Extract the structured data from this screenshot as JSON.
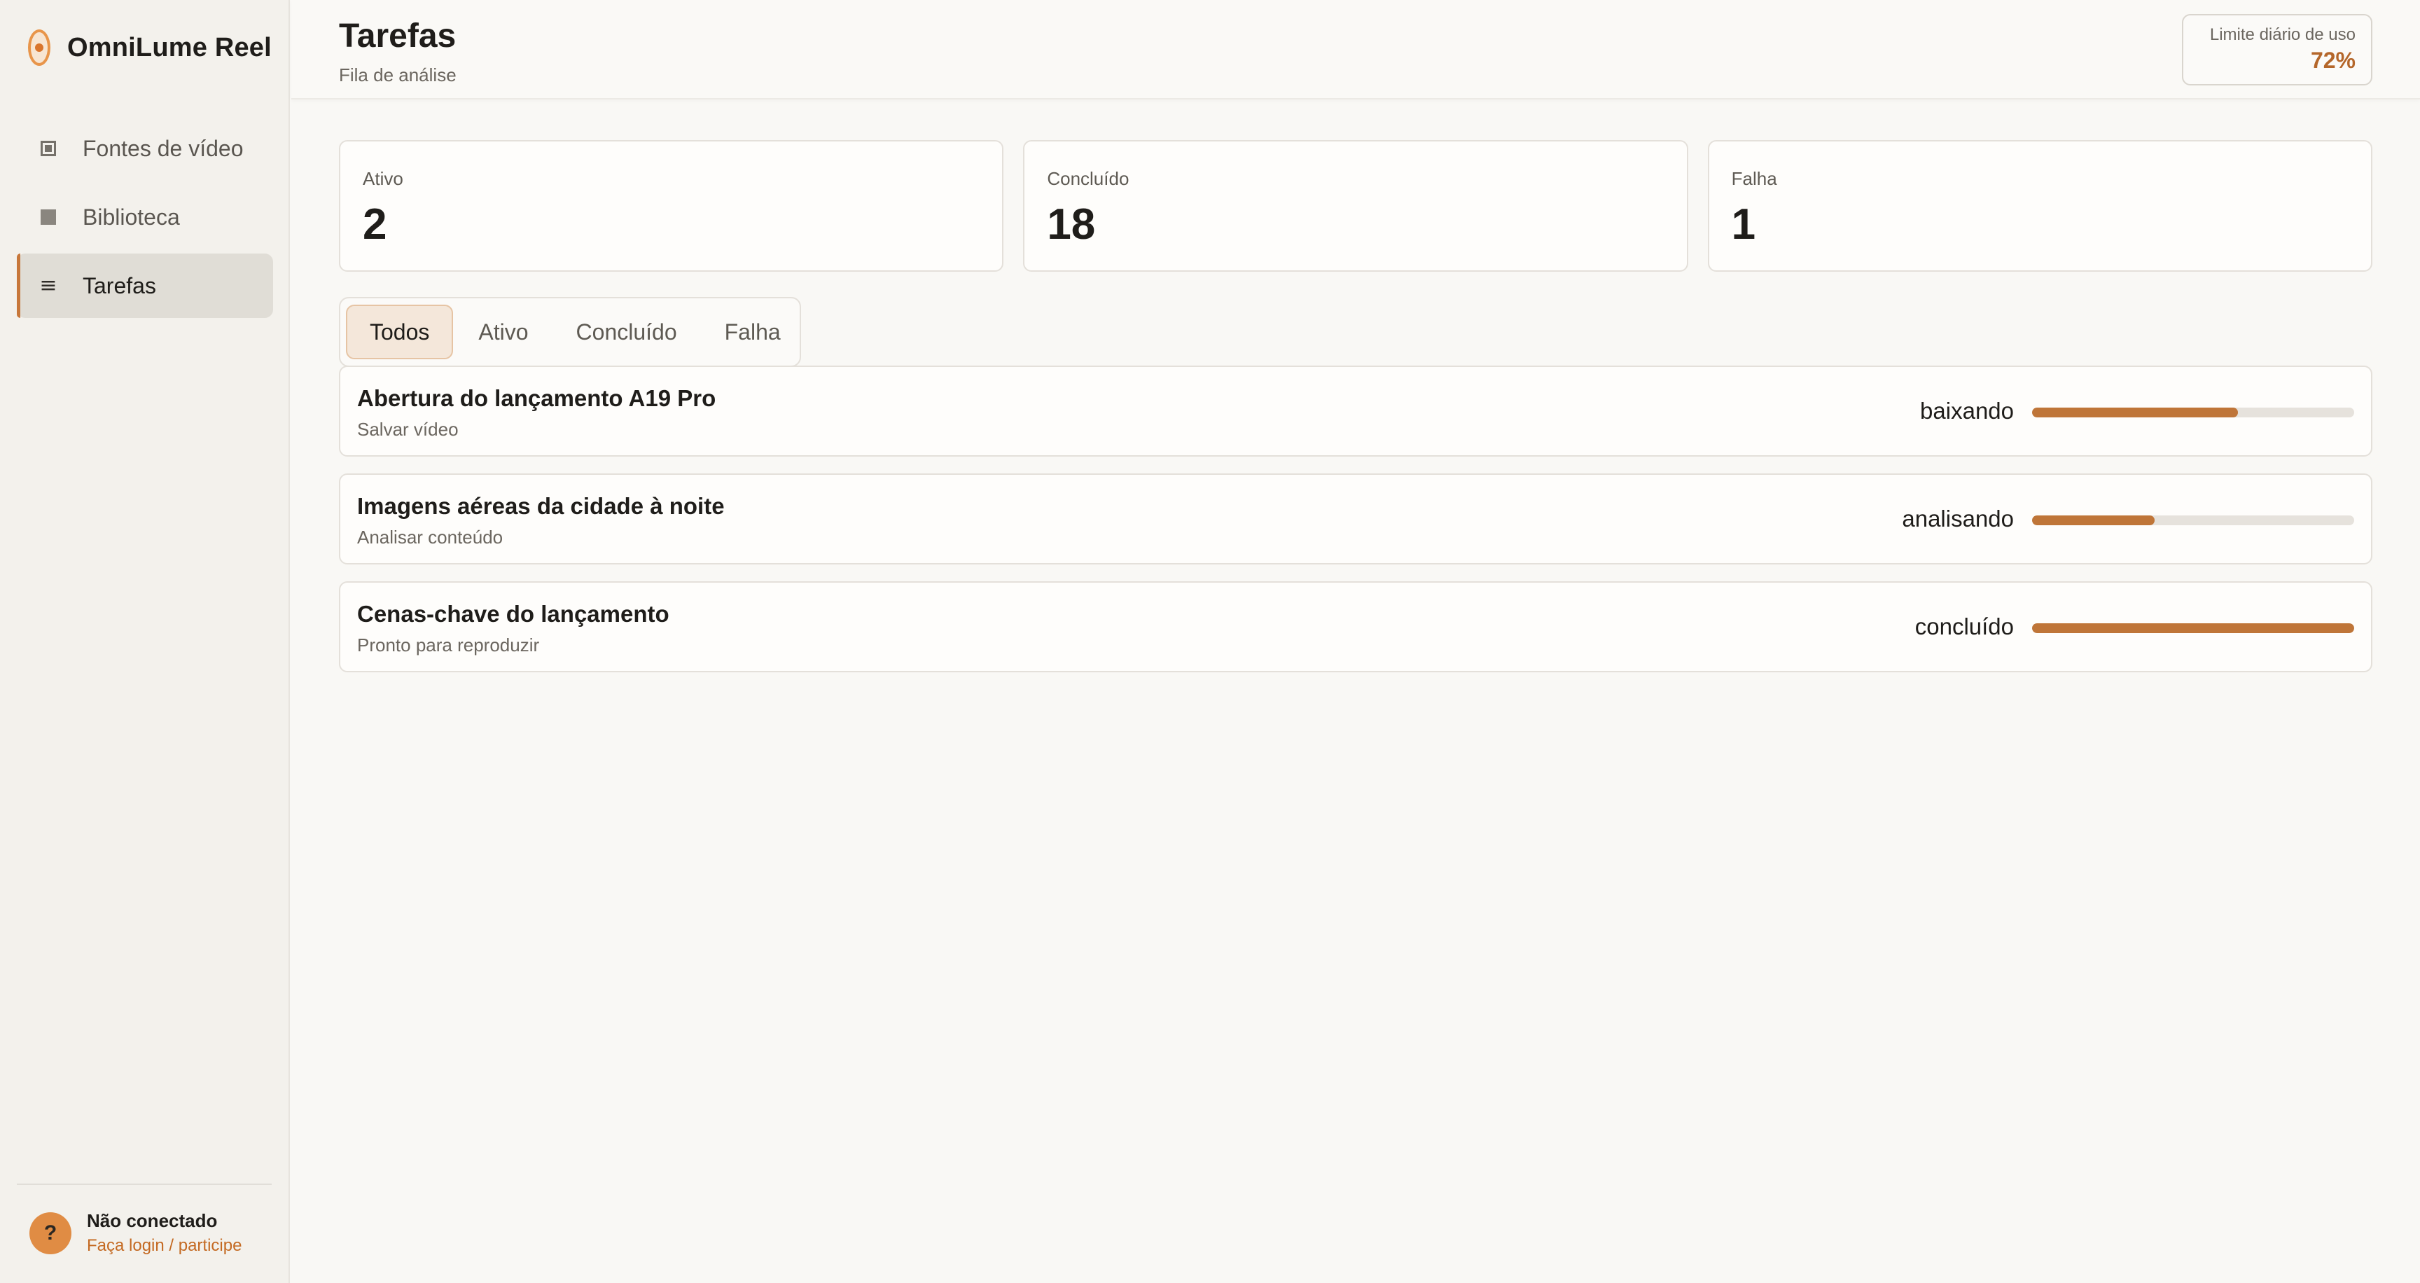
{
  "app": {
    "name": "OmniLume Reel",
    "accent": "#c7773a"
  },
  "sidebar": {
    "items": [
      {
        "label": "Fontes de vídeo",
        "icon": "video-source-icon",
        "active": false
      },
      {
        "label": "Biblioteca",
        "icon": "library-icon",
        "active": false
      },
      {
        "label": "Tarefas",
        "icon": "list-icon",
        "active": true
      }
    ],
    "footer": {
      "avatar": "?",
      "status": "Não conectado",
      "login": "Faça login / participe"
    }
  },
  "header": {
    "title": "Tarefas",
    "subtitle": "Fila de análise",
    "usage_label": "Limite diário de uso",
    "usage_value": "72%"
  },
  "stats": [
    {
      "label": "Ativo",
      "value": "2"
    },
    {
      "label": "Concluído",
      "value": "18"
    },
    {
      "label": "Falha",
      "value": "1"
    }
  ],
  "tabs": [
    {
      "label": "Todos",
      "active": true
    },
    {
      "label": "Ativo",
      "active": false
    },
    {
      "label": "Concluído",
      "active": false
    },
    {
      "label": "Falha",
      "active": false
    }
  ],
  "tasks": [
    {
      "title": "Abertura do lançamento A19 Pro",
      "subtitle": "Salvar vídeo",
      "state": "baixando",
      "progress": 0.64
    },
    {
      "title": "Imagens aéreas da cidade à noite",
      "subtitle": "Analisar conteúdo",
      "state": "analisando",
      "progress": 0.38
    },
    {
      "title": "Cenas-chave do lançamento",
      "subtitle": "Pronto para reproduzir",
      "state": "concluído",
      "progress": 1.0
    }
  ]
}
